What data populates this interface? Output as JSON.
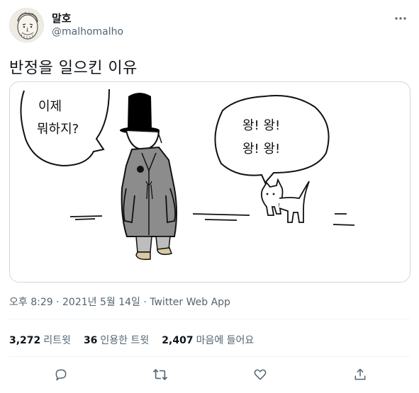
{
  "user": {
    "display_name": "말호",
    "handle": "@malhomalho"
  },
  "tweet": {
    "text": "반정을 일으킨 이유",
    "timestamp": "오후 8:29 · 2021년 5월 14일",
    "source_separator": " · ",
    "source": "Twitter Web App"
  },
  "comic": {
    "bubble_left_line1": "이제",
    "bubble_left_line2": "뭐하지?",
    "bubble_right_line1": "왕! 왕!",
    "bubble_right_line2": "왕! 왕!"
  },
  "stats": {
    "retweets_count": "3,272",
    "retweets_label": "리트윗",
    "quotes_count": "36",
    "quotes_label": "인용한 트윗",
    "likes_count": "2,407",
    "likes_label": "마음에 들어요"
  },
  "icons": {
    "reply": "reply-icon",
    "retweet": "retweet-icon",
    "like": "heart-icon",
    "share": "share-icon",
    "more": "more-icon"
  },
  "colors": {
    "text": "#0f1419",
    "secondary": "#536471",
    "border": "#cfd9de"
  }
}
